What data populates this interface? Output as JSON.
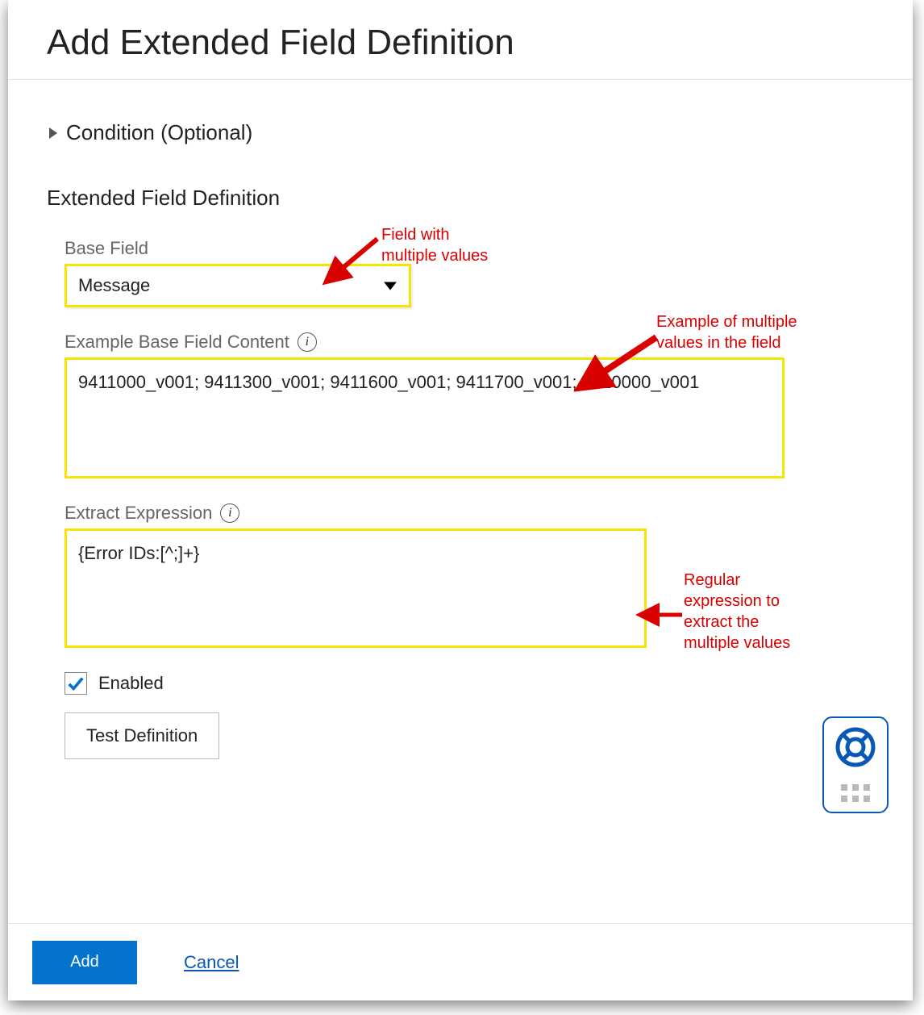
{
  "header": {
    "title": "Add Extended Field Definition"
  },
  "disclosure": {
    "label": "Condition (Optional)"
  },
  "section": {
    "title": "Extended Field Definition"
  },
  "baseField": {
    "label": "Base Field",
    "selected": "Message"
  },
  "exampleContent": {
    "label": "Example Base Field Content",
    "value": "9411000_v001; 9411300_v001; 9411600_v001; 9411700_v001; 9410000_v001"
  },
  "extractExpression": {
    "label": "Extract Expression",
    "value": "{Error IDs:[^;]+}"
  },
  "enabled": {
    "label": "Enabled",
    "checked": true
  },
  "buttons": {
    "test": "Test Definition",
    "add": "Add",
    "cancel": "Cancel"
  },
  "annotations": {
    "a1": "Field with multiple values",
    "a2": "Example of multiple values in the field",
    "a3": "Regular expression to extract the multiple values"
  },
  "colors": {
    "highlight": "#f5e500",
    "annotation": "#d90000",
    "primary": "#0572ce",
    "link": "#0a58b5"
  }
}
